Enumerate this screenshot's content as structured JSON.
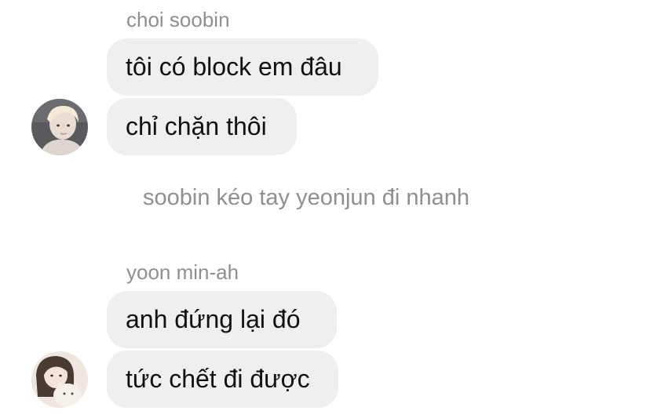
{
  "conversation": {
    "groups": [
      {
        "sender": "choi soobin",
        "avatar_icon": "avatar-photo-icon",
        "messages": [
          "tôi có block em đâu",
          "chỉ chặn thôi"
        ]
      },
      {
        "sender": "yoon min-ah",
        "avatar_icon": "avatar-photo-icon",
        "messages": [
          "anh đứng lại đó",
          "tức chết đi được"
        ]
      }
    ],
    "system_message": "soobin kéo tay yeonjun đi nhanh"
  },
  "colors": {
    "bubble": "#efefef",
    "meta_text": "#8e8e93",
    "message_text": "#111111"
  }
}
